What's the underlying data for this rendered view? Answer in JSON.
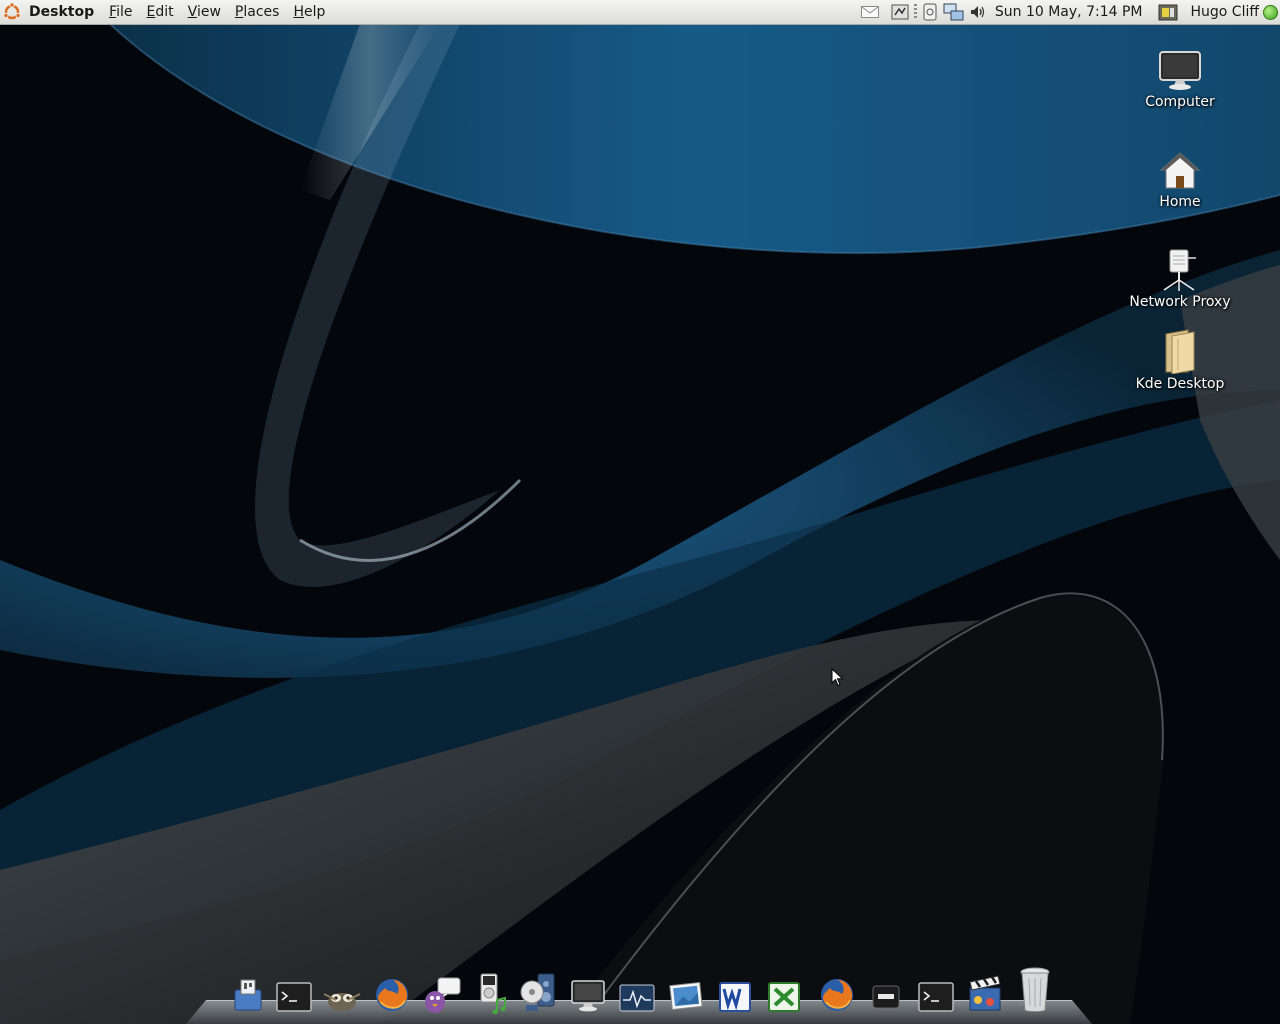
{
  "topbar": {
    "app_name": "Desktop",
    "menus": [
      {
        "label": "File",
        "mnemonic": "F",
        "rest": "ile"
      },
      {
        "label": "Edit",
        "mnemonic": "E",
        "rest": "dit"
      },
      {
        "label": "View",
        "mnemonic": "V",
        "rest": "iew"
      },
      {
        "label": "Places",
        "mnemonic": "P",
        "rest": "laces"
      },
      {
        "label": "Help",
        "mnemonic": "H",
        "rest": "elp"
      }
    ],
    "clock": "Sun 10 May,  7:14 PM",
    "user": "Hugo Cliff",
    "tray_icons": [
      "mail-icon",
      "network-tools-icon",
      "screen-icon",
      "network-connection-icon",
      "volume-icon",
      "battery-icon",
      "online-status-icon"
    ]
  },
  "desktop_icons": [
    {
      "label": "Computer",
      "icon": "computer-icon"
    },
    {
      "label": "Home",
      "icon": "home-folder-icon"
    },
    {
      "label": "Network Proxy",
      "icon": "network-proxy-icon"
    },
    {
      "label": "Kde Desktop",
      "icon": "folder-icon"
    }
  ],
  "dock": [
    "system-settings-icon",
    "terminal-icon",
    "gimp-icon",
    "firefox-icon",
    "pidgin-icon",
    "music-player-icon",
    "speakers-icon",
    "display-icon",
    "system-monitor-icon",
    "image-viewer-icon",
    "word-icon",
    "excel-icon",
    "firefox-icon",
    "drive-icon",
    "terminal-icon",
    "clapperboard-icon",
    "trash-icon"
  ],
  "colors": {
    "wallpaper_blue": "#1d5a86",
    "wallpaper_dark": "#02050a",
    "panel": "#e8e8e4"
  }
}
